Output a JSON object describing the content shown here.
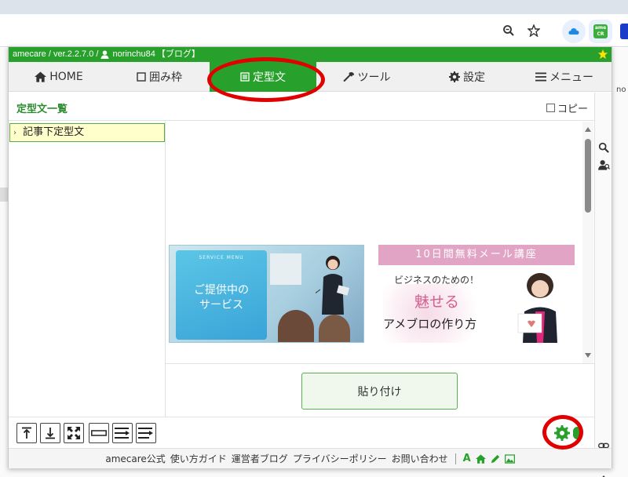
{
  "panel": {
    "app_name": "amecare",
    "title_left": "amecare / ver.2.2.7.0 /",
    "username": "norinchu84",
    "title_suffix": "【ブログ】",
    "extension_badge": "ame CR"
  },
  "nav": {
    "items": [
      {
        "label": "HOME",
        "icon": "home-icon"
      },
      {
        "label": "囲み枠",
        "icon": "square-icon"
      },
      {
        "label": "定型文",
        "icon": "list-icon",
        "active": true
      },
      {
        "label": "ツール",
        "icon": "wrench-icon"
      },
      {
        "label": "設定",
        "icon": "gear-icon"
      },
      {
        "label": "メニュー",
        "icon": "hamburger-icon"
      }
    ]
  },
  "list": {
    "title": "定型文一覧",
    "copy_label": "コピー",
    "tree_items": [
      {
        "label": "記事下定型文"
      }
    ]
  },
  "banners": {
    "left": {
      "sub": "SERVICE MENU",
      "line1": "ご提供中の",
      "line2": "サービス"
    },
    "right": {
      "header": "10日間無料メール講座",
      "line1": "ビジネスのための！",
      "line2": "魅せる",
      "line3": "アメブロの作り方"
    }
  },
  "paste_button": "貼り付け",
  "footer": {
    "links": [
      "amecare公式",
      "使い方ガイド",
      "運営者ブログ",
      "プライバシーポリシー",
      "お問い合わせ"
    ],
    "font_icon_letter": "A"
  },
  "colors": {
    "brand_green": "#27a12b",
    "annotation_red": "#e00000",
    "tree_highlight": "#ffffcc"
  },
  "bg_fragment": "no"
}
